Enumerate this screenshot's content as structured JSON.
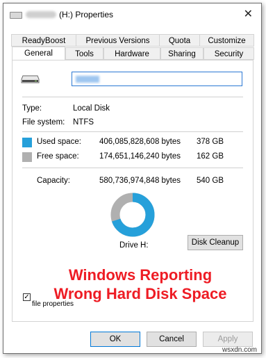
{
  "window": {
    "title": "(H:) Properties",
    "close_symbol": "✕"
  },
  "tabs_row1": [
    "ReadyBoost",
    "Previous Versions",
    "Quota",
    "Customize"
  ],
  "tabs_row2": [
    "General",
    "Tools",
    "Hardware",
    "Sharing",
    "Security"
  ],
  "active_tab": "General",
  "general": {
    "drive_icon": "hard-drive-icon",
    "type_label": "Type:",
    "type_value": "Local Disk",
    "fs_label": "File system:",
    "fs_value": "NTFS",
    "used_label": "Used space:",
    "used_bytes": "406,085,828,608 bytes",
    "used_gb": "378 GB",
    "free_label": "Free space:",
    "free_bytes": "174,651,146,240 bytes",
    "free_gb": "162 GB",
    "capacity_label": "Capacity:",
    "capacity_bytes": "580,736,974,848 bytes",
    "capacity_gb": "540 GB",
    "drive_label": "Drive H:",
    "disk_cleanup": "Disk Cleanup",
    "used_fraction": 0.699,
    "used_color": "#26a0da",
    "free_color": "#b0b0b0",
    "checkbox_label_tail": "file properties",
    "checkbox_checked": true
  },
  "overlay": {
    "line1": "Windows Reporting",
    "line2": "Wrong Hard Disk Space"
  },
  "buttons": {
    "ok": "OK",
    "cancel": "Cancel",
    "apply": "Apply"
  },
  "watermark": "wsxdn.com"
}
